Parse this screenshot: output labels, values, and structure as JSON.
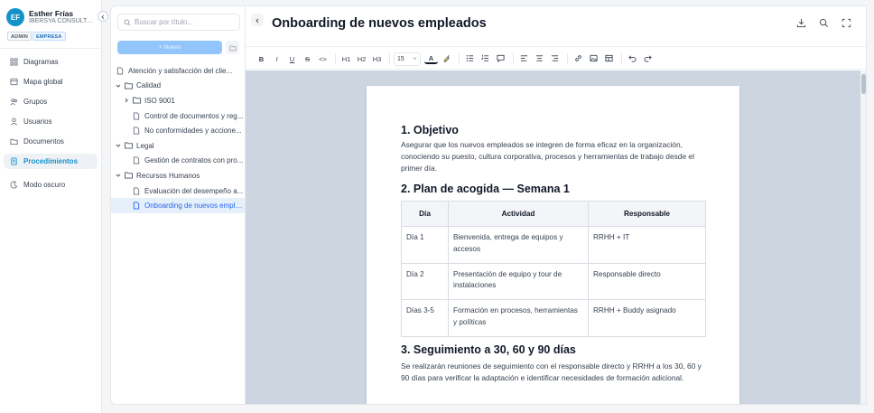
{
  "user": {
    "initials": "EF",
    "name": "Esther Frías",
    "company": "IBERSYA CONSULTOR…",
    "badges": [
      "ADMIN",
      "EMPRESA"
    ]
  },
  "nav": {
    "items": [
      {
        "label": "Diagramas",
        "icon": "diagram-icon"
      },
      {
        "label": "Mapa global",
        "icon": "map-icon"
      },
      {
        "label": "Grupos",
        "icon": "groups-icon"
      },
      {
        "label": "Usuarios",
        "icon": "user-icon"
      },
      {
        "label": "Documentos",
        "icon": "folder-icon"
      },
      {
        "label": "Procedimientos",
        "icon": "procedure-icon",
        "active": true
      }
    ],
    "dark_mode": "Modo oscuro"
  },
  "tree": {
    "search_placeholder": "Buscar por título...",
    "new_button": "+ Nuevo",
    "nodes": [
      "Atención y satisfacción del clie...",
      "Calidad",
      "ISO 9001",
      "Control de documentos y reg...",
      "No conformidades y accione...",
      "Legal",
      "Gestión de contratos con pro...",
      "Recursos Humanos",
      "Evaluación del desempeño a...",
      "Onboarding de nuevos emple..."
    ]
  },
  "editor": {
    "title": "Onboarding de nuevos empleados",
    "toolbar": {
      "bold": "B",
      "italic": "I",
      "underline": "U",
      "strike": "S",
      "code": "<>",
      "h1": "H1",
      "h2": "H2",
      "h3": "H3",
      "font_size": "15",
      "text_color": "A"
    }
  },
  "document": {
    "s1_title": "1. Objetivo",
    "s1_text": "Asegurar que los nuevos empleados se integren de forma eficaz en la organización, conociendo su puesto, cultura corporativa, procesos y herramientas de trabajo desde el primer día.",
    "s2_title": "2. Plan de acogida — Semana 1",
    "table": {
      "headers": [
        "Día",
        "Actividad",
        "Responsable"
      ],
      "rows": [
        [
          "Día 1",
          "Bienvenida, entrega de equipos y accesos",
          "RRHH + IT"
        ],
        [
          "Día 2",
          "Presentación de equipo y tour de instalaciones",
          "Responsable directo"
        ],
        [
          "Días 3-5",
          "Formación en procesos, herramientas y políticas",
          "RRHH + Buddy asignado"
        ]
      ]
    },
    "s3_title": "3. Seguimiento a 30, 60 y 90 días",
    "s3_text": "Se realizarán reuniones de seguimiento con el responsable directo y RRHH a los 30, 60 y 90 días para verificar la adaptación e identificar necesidades de formación adicional."
  },
  "colors": {
    "accent": "#1593c9",
    "canvas": "#cdd6e0",
    "selected_bg": "#e6f0fb"
  }
}
